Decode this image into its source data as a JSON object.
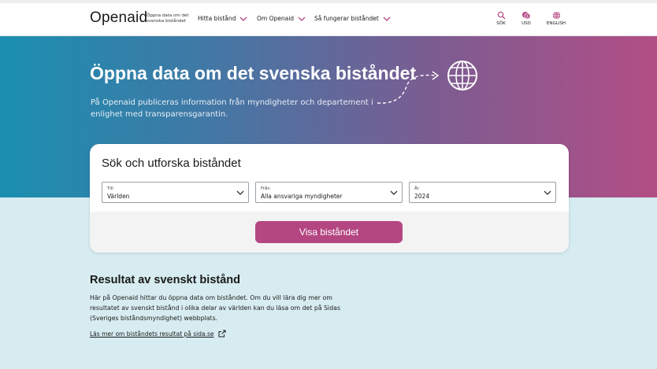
{
  "header": {
    "logo": "Openaid",
    "tagline": "Öppna data om det svenska biståndet",
    "nav": [
      {
        "label": "Hitta bistånd"
      },
      {
        "label": "Om Openaid"
      },
      {
        "label": "Så fungerar biståndet"
      }
    ],
    "utilities": {
      "search": "SÖK",
      "currency": "USD",
      "language": "ENGLISH"
    }
  },
  "hero": {
    "title": "Öppna data om det svenska biståndet",
    "text": "På Openaid publiceras information från myndigheter och departement i enlighet med transparensgarantin."
  },
  "search_card": {
    "title": "Sök och utforska biståndet",
    "selects": [
      {
        "label": "Till",
        "value": "Världen"
      },
      {
        "label": "Från",
        "value": "Alla ansvariga myndigheter"
      },
      {
        "label": "År",
        "value": "2024"
      }
    ],
    "button": "Visa biståndet"
  },
  "results": {
    "title": "Resultat av svenskt bistånd",
    "text": "Här på Openaid hittar du öppna data om biståndet. Om du vill lära dig mer om resultatet av svenskt bistånd i olika delar av världen kan du läsa om det på Sidas (Sveriges biståndsmyndighet) webbplats.",
    "link": "Läs mer om biståndets resultat på sida.se"
  },
  "colors": {
    "accent": "#b44682",
    "hero_start": "#1a8fb0",
    "hero_end": "#b24e85",
    "lower_bg": "#d7ecf1"
  },
  "icons": [
    "search-icon",
    "currency-icon",
    "globe-icon",
    "chevron-down-icon",
    "external-link-icon"
  ]
}
